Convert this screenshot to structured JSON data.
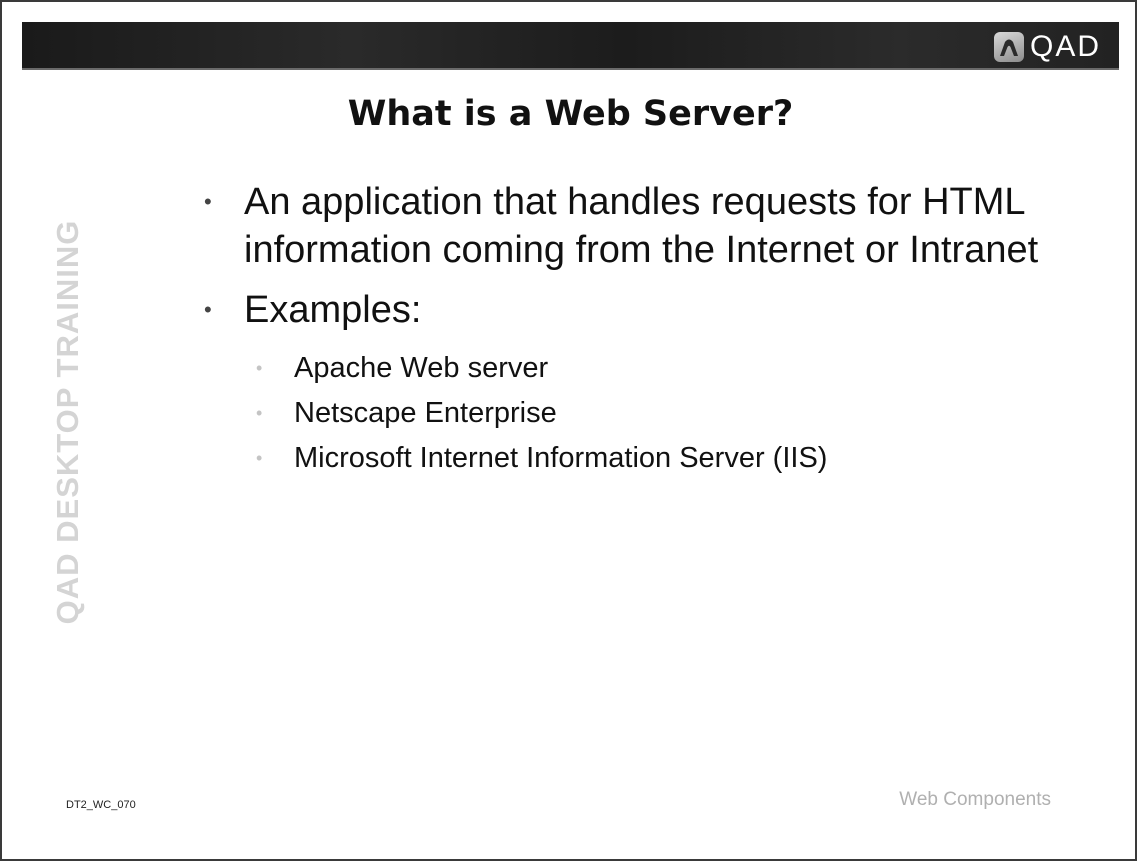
{
  "header": {
    "logo_text": "QAD",
    "logo_icon": "qad-logo-icon"
  },
  "title": "What is a Web Server?",
  "sidebar_watermark": "QAD DESKTOP TRAINING",
  "bullets": [
    {
      "text": "An application that handles requests for HTML information coming from the Internet or Intranet"
    },
    {
      "text": "Examples:",
      "children": [
        "Apache Web server",
        "Netscape Enterprise",
        "Microsoft Internet Information Server (IIS)"
      ]
    }
  ],
  "footer": {
    "slide_code": "DT2_WC_070",
    "section": "Web Components"
  },
  "colors": {
    "banner": "#1e1e1e",
    "watermark": "#d4d4d4",
    "sub_bullet": "#c4c4c4"
  }
}
